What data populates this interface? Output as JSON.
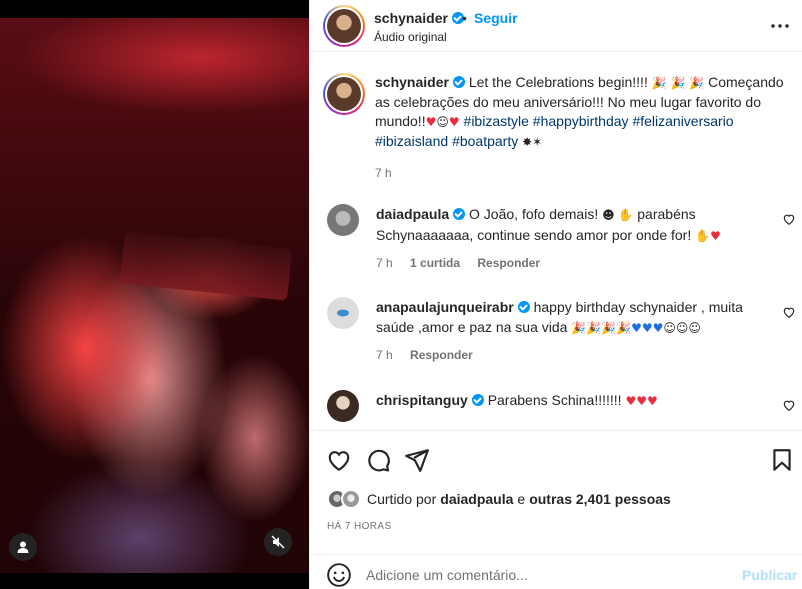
{
  "post": {
    "author": "schynaider",
    "follow_label": "Seguir",
    "separator": "•",
    "audio": "Áudio original"
  },
  "caption": {
    "username": "schynaider",
    "text_1": "Let the Celebrations begin!!!!",
    "text_2": "Começando as celebrações do meu aniversário!!! No meu lugar favorito do mundo!!",
    "hashtags": [
      "#ibizastyle",
      "#happybirthday",
      "#felizaniversario",
      "#ibizaisland",
      "#boatparty"
    ],
    "time": "7 h"
  },
  "comments": [
    {
      "username": "daiadpaula",
      "text_1": "O João, fofo demais!",
      "text_2": "parabéns Schynaaaaaaa, continue sendo amor por onde for!",
      "time": "7 h",
      "likes": "1 curtida",
      "reply": "Responder"
    },
    {
      "username": "anapaulajunqueirabr",
      "text": "happy birthday schynaider , muita saúde ,amor e paz na sua vida",
      "time": "7 h",
      "reply": "Responder"
    },
    {
      "username": "chrispitanguy",
      "text": "Parabens Schina!!!!!!!"
    }
  ],
  "likes": {
    "prefix": "Curtido por",
    "user": "daiadpaula",
    "connector": "e",
    "others": "outras 2,401 pessoas"
  },
  "time_ago": "HÁ 7 HORAS",
  "add_comment": {
    "placeholder": "Adicione um comentário...",
    "publish_label": "Publicar"
  },
  "icons": {
    "more": "more-icon",
    "like": "heart-icon",
    "comment": "comment-icon",
    "share": "share-icon",
    "save": "bookmark-icon",
    "emoji": "smile-icon",
    "mute": "muted-audio-icon",
    "tag": "user-tag-icon"
  },
  "colors": {
    "accent": "#0095f6",
    "hashtag": "#00376b",
    "muted_text": "#737373",
    "publish_disabled": "#b2dffc"
  }
}
